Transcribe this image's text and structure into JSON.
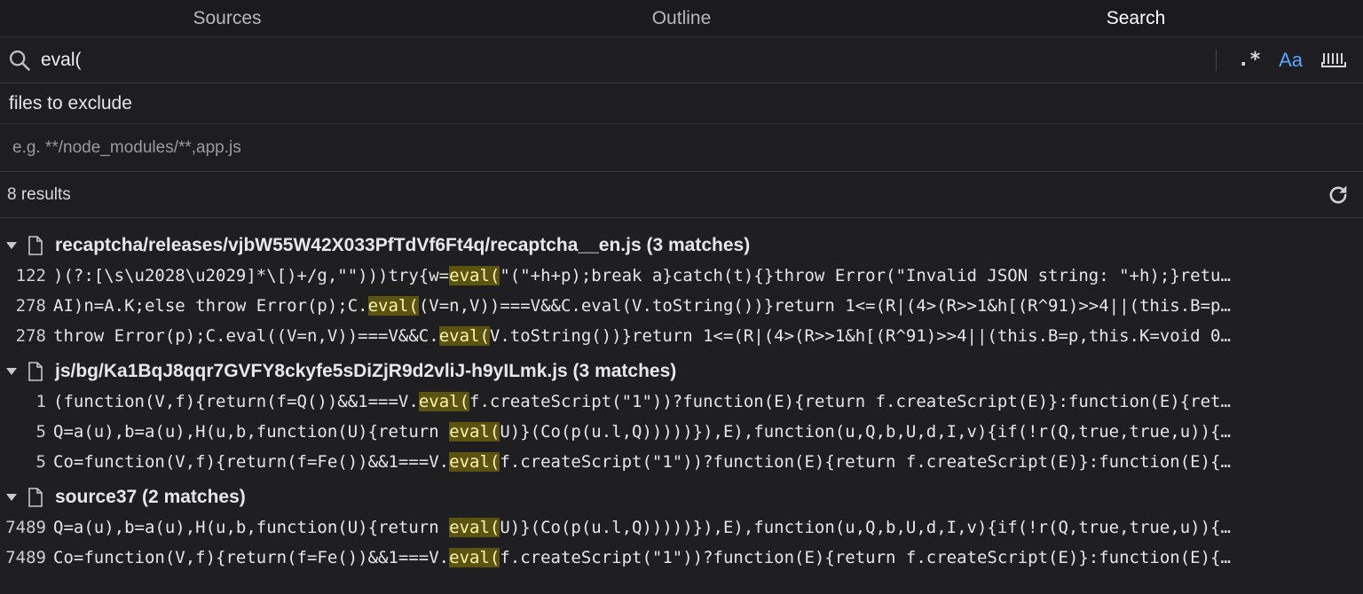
{
  "tabs": [
    {
      "label": "Sources",
      "active": false
    },
    {
      "label": "Outline",
      "active": false
    },
    {
      "label": "Search",
      "active": true
    }
  ],
  "search": {
    "value": "eval(",
    "regex_label": ".*",
    "case_label": "Aa",
    "icons": [
      "search-icon",
      "regex-toggle",
      "match-case-toggle",
      "whole-word-toggle"
    ]
  },
  "exclude": {
    "label": "files to exclude",
    "placeholder": "e.g. **/node_modules/**,app.js"
  },
  "results_summary": "8 results",
  "colors": {
    "highlight_bg": "#5b5312",
    "highlight_fg": "#fff3a8",
    "accent": "#57a6ff"
  },
  "groups": [
    {
      "file": "recaptcha/releases/vjbW55W42X033PfTdVf6Ft4q/recaptcha__en.js (3 matches)",
      "lines": [
        {
          "line": "122",
          "pre": ")(?:[\\s\\u2028\\u2029]*\\[)+/g,\"\")))try{w=",
          "match": "eval(",
          "post": "\"(\"+h+p);break a}catch(t){}throw Error(\"Invalid JSON string: \"+h);}retu…"
        },
        {
          "line": "278",
          "pre": "AI)n=A.K;else throw Error(p);C.",
          "match": "eval(",
          "post": "(V=n,V))===V&&C.eval(V.toString())}return 1<=(R|(4>(R>>1&h[(R^91)>>4||(this.B=p…"
        },
        {
          "line": "278",
          "pre": "throw Error(p);C.eval((V=n,V))===V&&C.",
          "match": "eval(",
          "post": "V.toString())}return 1<=(R|(4>(R>>1&h[(R^91)>>4||(this.B=p,this.K=void 0…"
        }
      ]
    },
    {
      "file": "js/bg/Ka1BqJ8qqr7GVFY8ckyfe5sDiZjR9d2vliJ-h9yILmk.js (3 matches)",
      "lines": [
        {
          "line": "1",
          "pre": "(function(V,f){return(f=Q())&&1===V.",
          "match": "eval(",
          "post": "f.createScript(\"1\"))?function(E){return f.createScript(E)}:function(E){ret…"
        },
        {
          "line": "5",
          "pre": "Q=a(u),b=a(u),H(u,b,function(U){return ",
          "match": "eval(",
          "post": "U)}(Co(p(u.l,Q)))))}),E),function(u,Q,b,U,d,I,v){if(!r(Q,true,true,u)){…"
        },
        {
          "line": "5",
          "pre": "Co=function(V,f){return(f=Fe())&&1===V.",
          "match": "eval(",
          "post": "f.createScript(\"1\"))?function(E){return f.createScript(E)}:function(E){…"
        }
      ]
    },
    {
      "file": "source37 (2 matches)",
      "lines": [
        {
          "line": "7489",
          "pre": "Q=a(u),b=a(u),H(u,b,function(U){return ",
          "match": "eval(",
          "post": "U)}(Co(p(u.l,Q)))))}),E),function(u,Q,b,U,d,I,v){if(!r(Q,true,true,u)){…"
        },
        {
          "line": "7489",
          "pre": "Co=function(V,f){return(f=Fe())&&1===V.",
          "match": "eval(",
          "post": "f.createScript(\"1\"))?function(E){return f.createScript(E)}:function(E){…"
        }
      ]
    }
  ]
}
